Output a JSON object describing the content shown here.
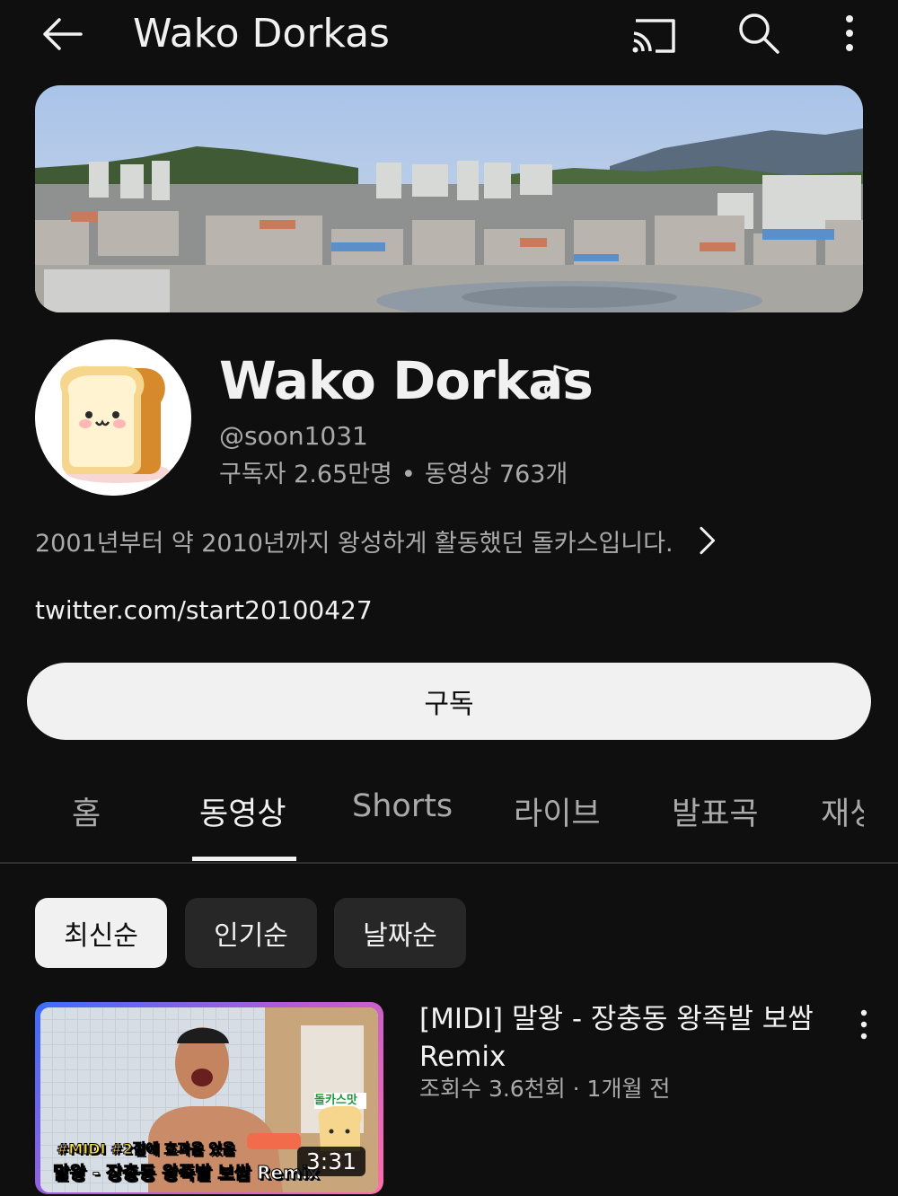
{
  "topbar": {
    "title": "Wako Dorkas",
    "back_icon": "arrow-back-icon",
    "cast_icon": "cast-icon",
    "search_icon": "search-icon",
    "more_icon": "more-vert-icon"
  },
  "channel": {
    "name": "Wako Dorkas",
    "badge_icon": "music-note-icon",
    "handle": "@soon1031",
    "subscribers": "구독자 2.65만명",
    "separator": "•",
    "videos_count": "동영상 763개",
    "description": "2001년부터 약 2010년까지 왕성하게 활동했던 돌카스입니다.",
    "link": "twitter.com/start20100427",
    "subscribe_label": "구독"
  },
  "tabs": [
    {
      "label": "홈"
    },
    {
      "label": "동영상"
    },
    {
      "label": "Shorts"
    },
    {
      "label": "라이브"
    },
    {
      "label": "발표곡"
    },
    {
      "label": "재생"
    }
  ],
  "active_tab": "동영상",
  "sort_chips": [
    {
      "label": "최신순"
    },
    {
      "label": "인기순"
    },
    {
      "label": "날짜순"
    }
  ],
  "selected_chip": "최신순",
  "videos": [
    {
      "title": "[MIDI] 말왕 - 장충동 왕족발 보쌈 Remix",
      "meta": "조회수 3.6천회 · 1개월 전",
      "duration": "3:31",
      "thumb_caption_top": "#MIDI #2절에 효과음 있음",
      "thumb_caption_bottom": "말왕 - 장충동 왕족발 보쌈 Remix",
      "thumb_tag": "돌카스맛"
    }
  ],
  "colors": {
    "background": "#0f0f0f",
    "text_primary": "#f1f1f1",
    "text_secondary": "#aaaaaa",
    "chip_bg": "#272727"
  }
}
